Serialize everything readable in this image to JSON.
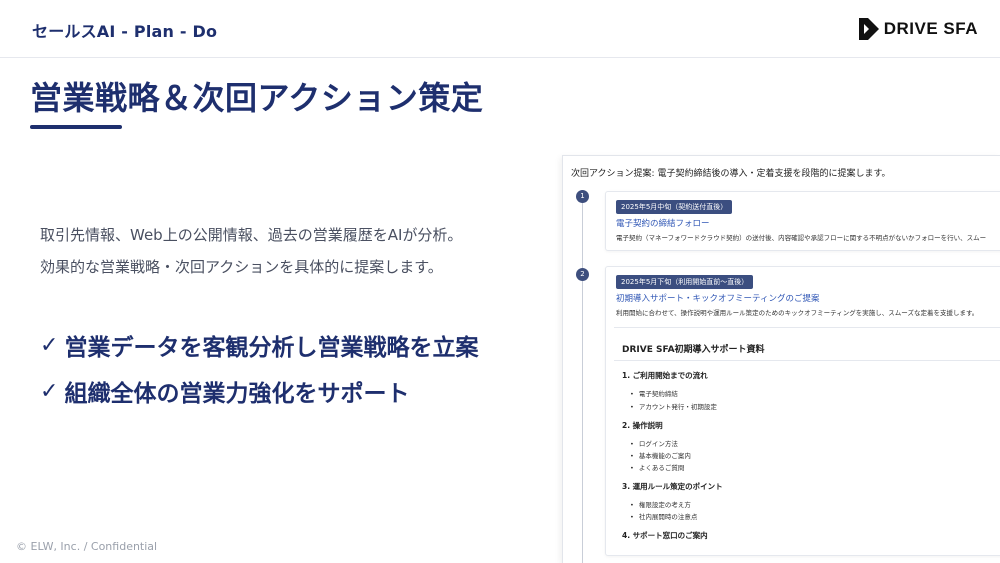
{
  "header": {
    "brand": "セールスAI - Plan - Do",
    "logo_text": "DRIVE SFA"
  },
  "page": {
    "title": "営業戦略＆次回アクション策定"
  },
  "description": [
    "取引先情報、Web上の公開情報、過去の営業履歴をAIが分析。",
    "効果的な営業戦略・次回アクションを具体的に提案します。"
  ],
  "points": [
    {
      "check": "✓",
      "text": "営業データを客観分析し営業戦略を立案"
    },
    {
      "check": "✓",
      "text": "組織全体の営業力強化をサポート"
    }
  ],
  "footer": "© ELW, Inc. / Confidential",
  "panel": {
    "heading": "次回アクション提案: 電子契約締結後の導入・定着支援を段階的に提案します。",
    "steps": [
      {
        "num": "1",
        "tag": "2025年5月中旬（契約送付直後）",
        "title": "電子契約の締結フォロー",
        "desc": "電子契約（マネーフォワードクラウド契約）の送付後、内容確認や承認フローに関する不明点がないかフォローを行い、スムー"
      },
      {
        "num": "2",
        "tag": "2025年5月下旬（利用開始直前～直後）",
        "title": "初期導入サポート・キックオフミーティングのご提案",
        "desc": "利用開始に合わせて、操作説明や運用ルール策定のためのキックオフミーティングを実施し、スムーズな定着を支援します。"
      }
    ],
    "doc": {
      "title": "DRIVE SFA初期導入サポート資料",
      "sections": [
        {
          "heading": "1. ご利用開始までの流れ",
          "items": [
            "電子契約締結",
            "アカウント発行・初期設定"
          ]
        },
        {
          "heading": "2. 操作説明",
          "items": [
            "ログイン方法",
            "基本機能のご案内",
            "よくあるご質問"
          ]
        },
        {
          "heading": "3. 運用ルール策定のポイント",
          "items": [
            "権限設定の考え方",
            "社内展開時の注意点"
          ]
        },
        {
          "heading": "4. サポート窓口のご案内",
          "items": []
        }
      ]
    }
  }
}
